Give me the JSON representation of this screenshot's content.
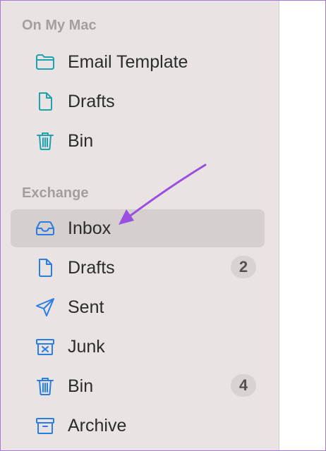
{
  "sections": [
    {
      "title": "On My Mac",
      "items": [
        {
          "label": "Email Template",
          "icon": "folder-icon"
        },
        {
          "label": "Drafts",
          "icon": "document-icon"
        },
        {
          "label": "Bin",
          "icon": "trash-icon"
        }
      ]
    },
    {
      "title": "Exchange",
      "items": [
        {
          "label": "Inbox",
          "icon": "inbox-tray-icon",
          "selected": true
        },
        {
          "label": "Drafts",
          "icon": "document-icon",
          "badge": "2"
        },
        {
          "label": "Sent",
          "icon": "paper-plane-icon"
        },
        {
          "label": "Junk",
          "icon": "junk-box-icon"
        },
        {
          "label": "Bin",
          "icon": "trash-icon",
          "badge": "4"
        },
        {
          "label": "Archive",
          "icon": "archive-box-icon"
        }
      ]
    }
  ],
  "colors": {
    "local_icon": "#1fa2b0",
    "exchange_icon": "#2a7de1",
    "annotation_arrow": "#9b4fe0",
    "sidebar_bg": "#e9e4e3",
    "selected_bg": "#d5cfcd"
  }
}
